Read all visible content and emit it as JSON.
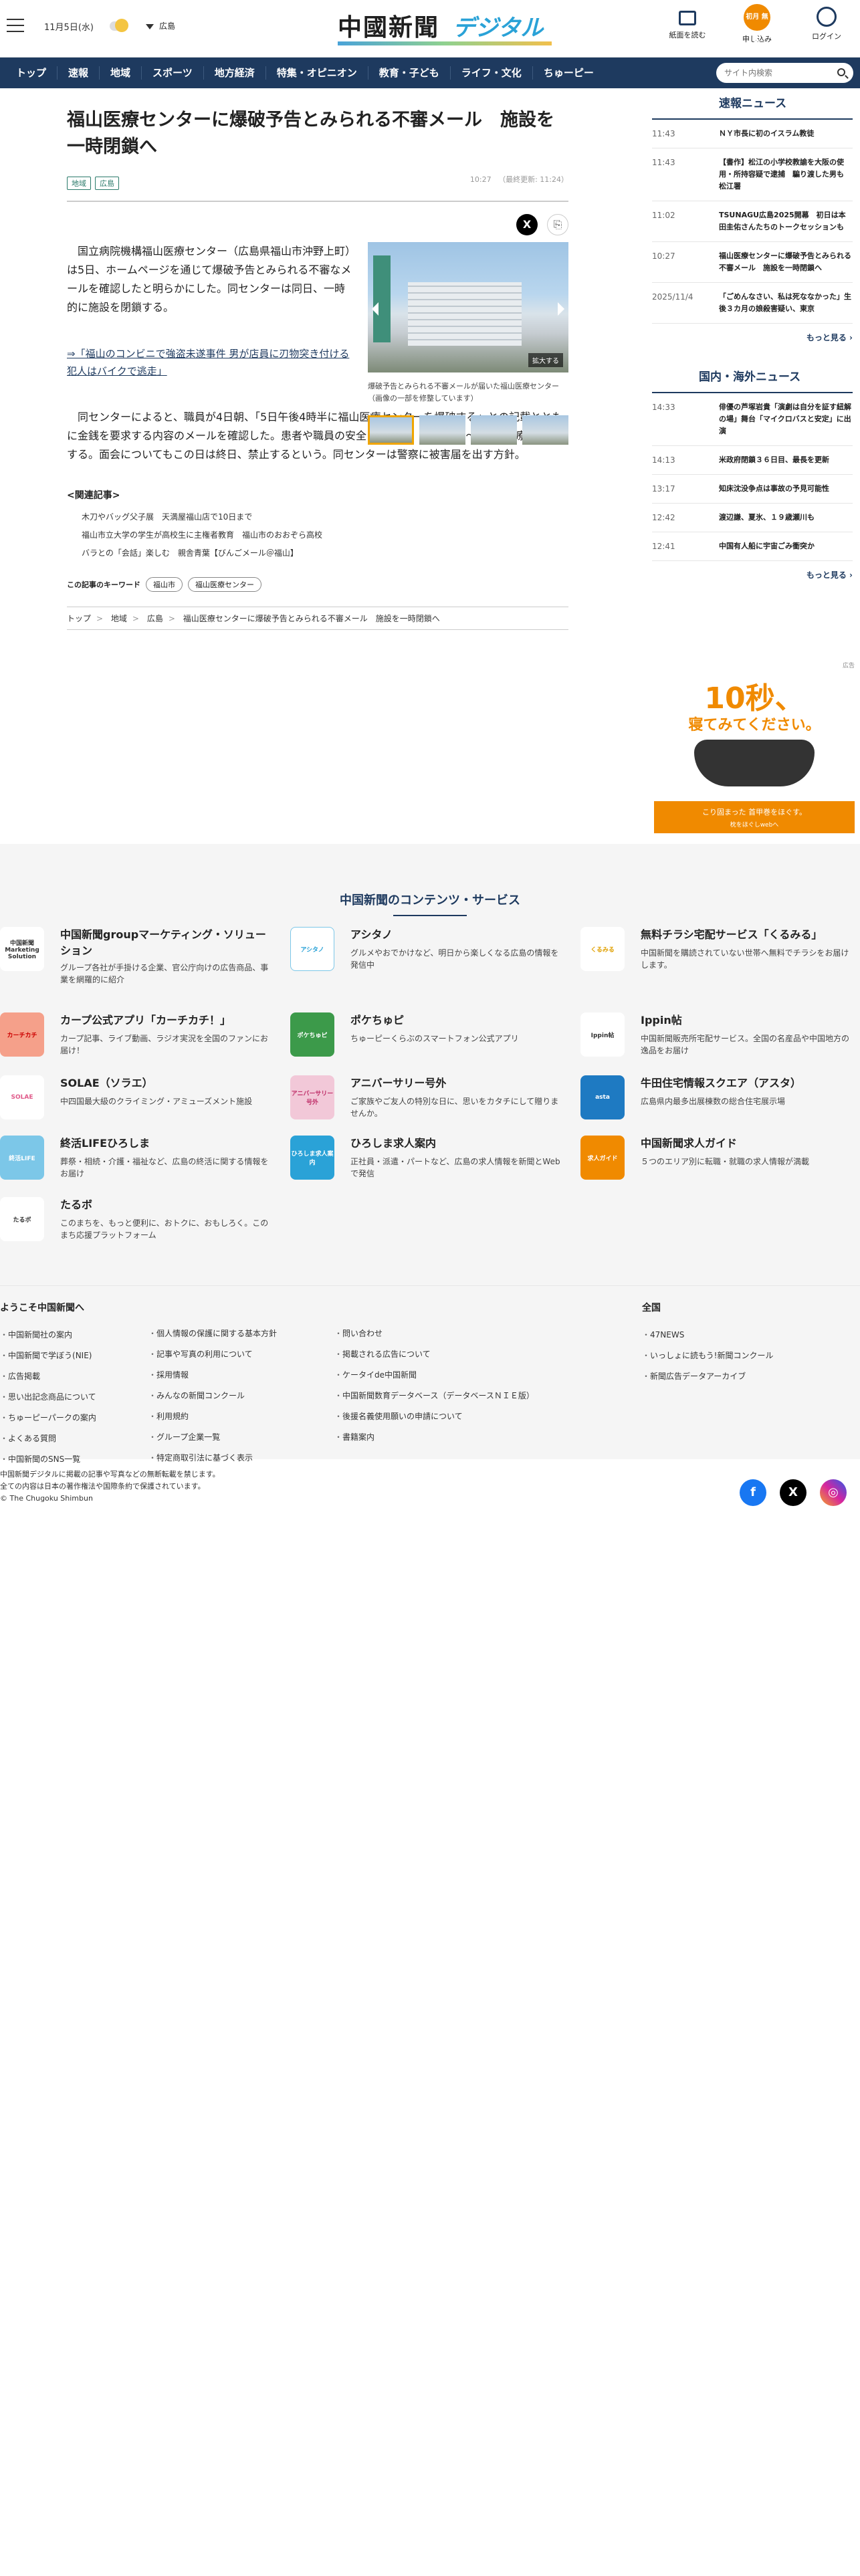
{
  "header": {
    "date": "11月5日(水)",
    "region": "広島",
    "logo_main": "中國新聞",
    "logo_sub": "デジタル",
    "icons": {
      "newspaper": "紙面を読む",
      "subscribe": "申し込み",
      "subscribe_badge": "初月 無料",
      "login": "ログイン"
    }
  },
  "nav": {
    "items": [
      "トップ",
      "速報",
      "地域",
      "スポーツ",
      "地方経済",
      "特集・オピニオン",
      "教育・子ども",
      "ライフ・文化",
      "ちゅーピー"
    ],
    "search_placeholder": "サイト内検索"
  },
  "article": {
    "title": "福山医療センターに爆破予告とみられる不審メール　施設を一時閉鎖へ",
    "tags": [
      "地域",
      "広島"
    ],
    "published": "10:27",
    "updated": "（最終更新: 11:24）",
    "paragraph1": "国立病院機構福山医療センター（広島県福山市沖野上町）は5日、ホームページを通じて爆破予告とみられる不審なメールを確認したと明らかにした。同センターは同日、一時的に施設を閉鎖する。",
    "link": "⇒「福山のコンビニで強盗未遂事件 男が店員に刃物突き付ける 犯人はバイクで逃走」",
    "paragraph2": "同センターによると、職員が4日朝、「5日午後4時半に福山医療センターを爆破する」との記載とともに金銭を要求する内容のメールを確認した。患者や職員の安全に配慮し、5日午後3～5時の診療を中止する。面会についてもこの日は終日、禁止するという。同センターは警察に被害届を出す方針。",
    "photo_enlarge": "拡大する",
    "photo_caption": "爆破予告とみられる不審メールが届いた福山医療センター（画像の一部を修整しています）",
    "related_title": "<関連記事>",
    "related": [
      "木刀やバッグ父子展　天満屋福山店で10日まで",
      "福山市立大学の学生が高校生に主権者教育　福山市のおおぞら高校",
      "バラとの「会話」楽しむ　親舎青葉【びんごメール＠福山】"
    ],
    "keywords_label": "この記事のキーワード",
    "keywords": [
      "福山市",
      "福山医療センター"
    ],
    "breadcrumb": [
      "トップ",
      "地域",
      "広島",
      "福山医療センターに爆破予告とみられる不審メール　施設を一時閉鎖へ"
    ]
  },
  "sidebar": {
    "breaking_title": "速報ニュース",
    "breaking": [
      {
        "time": "11:43",
        "headline": "ＮＹ市長に初のイスラム教徒"
      },
      {
        "time": "11:43",
        "headline": "【書作】松江の小学校教諭を大阪の使用・所持容疑で逮捕　騙り渡した男も　松江署"
      },
      {
        "time": "11:02",
        "headline": "TSUNAGU広島2025開幕　初日は本田圭佑さんたちのトークセッションも"
      },
      {
        "time": "10:27",
        "headline": "福山医療センターに爆破予告とみられる不審メール　施設を一時閉鎖へ"
      },
      {
        "time": "2025/11/4",
        "headline": "「ごめんなさい、私は死ななかった」生後３カ月の娘殺害疑い、東京"
      }
    ],
    "more": "もっと見る",
    "intl_title": "国内・海外ニュース",
    "intl": [
      {
        "time": "14:33",
        "headline": "俳優の芦塚岩貴「演劇は自分を証す紐解の場」舞台「マイクロバスと安定」に出演"
      },
      {
        "time": "14:13",
        "headline": "米政府閉鎖３６日目、最長を更新"
      },
      {
        "time": "13:17",
        "headline": "知床沈没争点は事故の予見可能性"
      },
      {
        "time": "12:42",
        "headline": "渡辺謙、夏氷、１９歳瀬川も"
      },
      {
        "time": "12:41",
        "headline": "中国有人船に宇宙ごみ衝突か"
      }
    ],
    "ad": {
      "label": "広告",
      "headline": "10秒、",
      "sub": "寝てみてください。",
      "button": "こり固まった 首甲巻をほぐす。",
      "button_sub": "枕をほぐしwebへ"
    }
  },
  "services": {
    "title": "中国新聞のコンテンツ・サービス",
    "items": [
      {
        "name": "中国新聞groupマーケティング・ソリューション",
        "desc": "グループ各社が手掛ける企業、官公庁向けの広告商品、事業を網羅的に紹介",
        "logo": "中国新聞 Marketing Solution"
      },
      {
        "name": "アシタノ",
        "desc": "グルメやおでかけなど、明日から楽しくなる広島の情報を発信中",
        "logo": "アシタノ"
      },
      {
        "name": "無料チラシ宅配サービス「くるみる」",
        "desc": "中国新聞を購読されていない世帯へ無料でチラシをお届けします。",
        "logo": "くるみる"
      },
      {
        "name": "カープ公式アプリ「カーチカチ！」",
        "desc": "カープ記事、ライブ動画、ラジオ実況を全国のファンにお届け！",
        "logo": "カーチカチ"
      },
      {
        "name": "ポケちゅピ",
        "desc": "ちゅーピーくらぶのスマートフォン公式アプリ",
        "logo": "ポケちゅピ"
      },
      {
        "name": "Ippin帖",
        "desc": "中国新聞販売所宅配サービス。全国の名産品や中国地方の逸品をお届け",
        "logo": "Ippin帖"
      },
      {
        "name": "SOLAE（ソラエ）",
        "desc": "中四国最大級のクライミング・アミューズメント施設",
        "logo": "SOLAE"
      },
      {
        "name": "アニバーサリー号外",
        "desc": "ご家族やご友人の特別な日に、思いをカタチにして贈りませんか。",
        "logo": "アニバーサリー号外"
      },
      {
        "name": "牛田住宅情報スクエア（アスタ）",
        "desc": "広島県内最多出展棟数の総合住宅展示場",
        "logo": "asta"
      },
      {
        "name": "終活LIFEひろしま",
        "desc": "葬祭・相続・介護・福祉など、広島の終活に関する情報をお届け",
        "logo": "終活LIFE"
      },
      {
        "name": "ひろしま求人案内",
        "desc": "正社員・派遣・パートなど、広島の求人情報を新聞とWebで発信",
        "logo": "ひろしま求人案内"
      },
      {
        "name": "中国新聞求人ガイド",
        "desc": "５つのエリア別に転職・就職の求人情報が満載",
        "logo": "求人ガイド"
      },
      {
        "name": "たるボ",
        "desc": "このまちを、もっと便利に、おトクに、おもしろく。このまち応援プラットフォーム",
        "logo": "たるボ"
      }
    ]
  },
  "footer": {
    "welcome_title": "ようこそ中国新聞へ",
    "col1": [
      "中国新聞社の案内",
      "中国新聞で学ぼう(NIE)",
      "広告掲載",
      "思い出記念商品について",
      "ちゅーピーパークの案内",
      "よくある質問",
      "中国新聞のSNS一覧"
    ],
    "col2": [
      "個人情報の保護に関する基本方針",
      "記事や写真の利用について",
      "採用情報",
      "みんなの新聞コンクール",
      "利用規約",
      "グループ企業一覧",
      "特定商取引法に基づく表示"
    ],
    "col3": [
      "問い合わせ",
      "掲載される広告について",
      "ケータイde中国新聞",
      "中国新聞数育データベース（データベースＮＩＥ版）",
      "後援名義使用願いの申請について",
      "書籍案内"
    ],
    "national_title": "全国",
    "col4": [
      "47NEWS",
      "いっしょに読もう!新聞コンクール",
      "新聞広告データアーカイブ"
    ],
    "copyright1": "中国新聞デジタルに掲載の記事や写真などの無断転載を禁じます。",
    "copyright2": "全ての内容は日本の著作権法や国際条約で保護されています。",
    "copyright3": "© The Chugoku Shimbun",
    "social": {
      "facebook": "f",
      "x": "X",
      "instagram": "◎"
    }
  },
  "colors": {
    "navy": "#1e3a5f",
    "accent": "#f08a00",
    "tag": "#2a7a6a"
  }
}
